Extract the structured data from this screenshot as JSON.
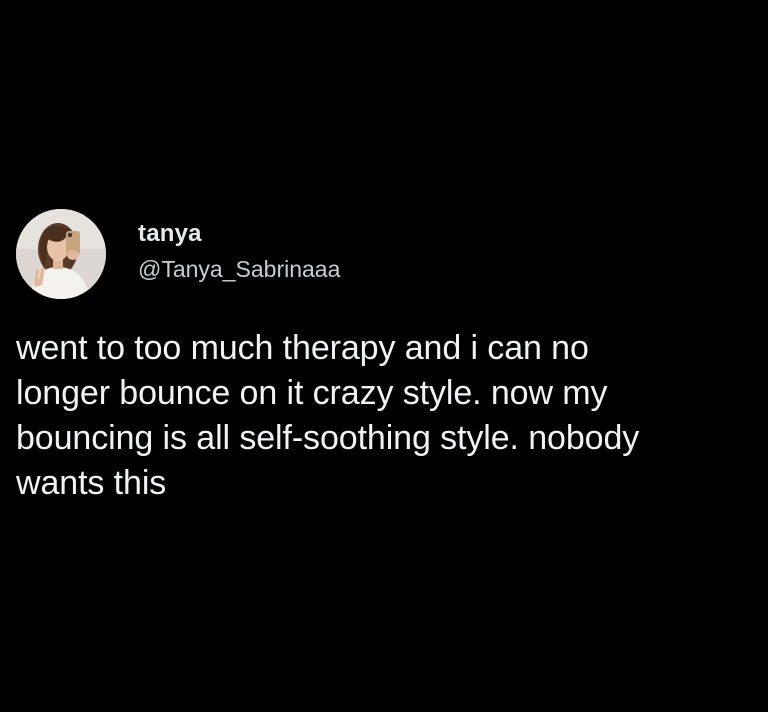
{
  "tweet": {
    "author": {
      "display_name": "tanya",
      "handle": "@Tanya_Sabrinaaa",
      "avatar_icon": "profile-photo-avatar"
    },
    "text": "went to too much therapy and i can no\nlonger bounce on it crazy style. now my\nbouncing is all self-soothing style. nobody\nwants this"
  },
  "colors": {
    "background": "#000000",
    "primary_text": "#e7e9ea",
    "secondary_text": "#c9cdd1"
  }
}
